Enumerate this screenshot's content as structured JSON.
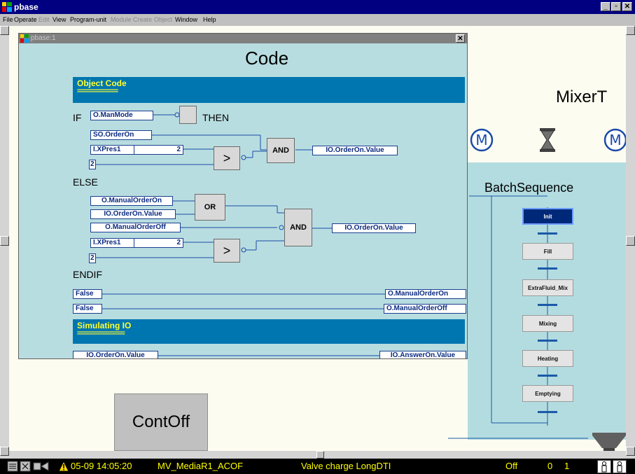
{
  "window": {
    "title": "pbase",
    "buttons": [
      "_",
      "▫",
      "✕"
    ]
  },
  "menu": {
    "items": [
      {
        "label": "File",
        "enabled": true
      },
      {
        "label": "Operate",
        "enabled": true
      },
      {
        "label": "Edit",
        "enabled": false
      },
      {
        "label": "View",
        "enabled": true
      },
      {
        "label": "Program-unit",
        "enabled": true
      },
      {
        "label": "Module",
        "enabled": false
      },
      {
        "label": "Create",
        "enabled": false
      },
      {
        "label": "Object",
        "enabled": false
      },
      {
        "label": "Window",
        "enabled": true
      },
      {
        "label": "Help",
        "enabled": true
      }
    ]
  },
  "mdi": {
    "title": "pbase:1",
    "close": "✕"
  },
  "code": {
    "heading": "Code",
    "object_code": {
      "title": "Object Code",
      "rule": "============"
    },
    "kw_if": "IF",
    "kw_then": "THEN",
    "kw_else": "ELSE",
    "kw_endif": "ENDIF",
    "if_cond": "O.ManMode",
    "then": {
      "in1": "SO.OrderOn",
      "in2": "I.XPres1",
      "in2_val": "2",
      "in3": "2",
      "cmp": ">",
      "gate": "AND",
      "out": "IO.OrderOn.Value"
    },
    "else": {
      "in1": "O.ManualOrderOn",
      "in2": "IO.OrderOn.Value",
      "or_gate": "OR",
      "in3": "O.ManualOrderOff",
      "in4": "I.XPres1",
      "in4_val": "2",
      "in5": "2",
      "cmp": ">",
      "gate": "AND",
      "out": "IO.OrderOn.Value"
    },
    "assign1": {
      "val": "False",
      "target": "O.ManualOrderOn"
    },
    "assign2": {
      "val": "False",
      "target": "O.ManualOrderOff"
    },
    "simulating": {
      "title": "Simulating IO",
      "rule": "=============="
    },
    "sim_row": {
      "left": "IO.OrderOn.Value",
      "right": "IO.AnswerOn.Value"
    }
  },
  "right": {
    "mixer_title": "MixerT",
    "batch_title": "BatchSequence",
    "steps": [
      {
        "label": "Init",
        "active": true
      },
      {
        "label": "Fill",
        "active": false
      },
      {
        "label": "ExtraFluid_Mix",
        "active": false
      },
      {
        "label": "Mixing",
        "active": false
      },
      {
        "label": "Heating",
        "active": false
      },
      {
        "label": "Emptying",
        "active": false
      }
    ]
  },
  "contoff": "ContOff",
  "status": {
    "date": "05-09 14:05:20",
    "tag": "MV_MediaR1_ACOF",
    "message": "Valve charge LongDTI",
    "state": "Off",
    "v1": "0",
    "v2": "1"
  },
  "colors": {
    "titlebar": "#000080",
    "panel": "#b3dce0",
    "section": "#0076b0",
    "section_text": "#ffff33",
    "status_text": "#ffff00"
  }
}
